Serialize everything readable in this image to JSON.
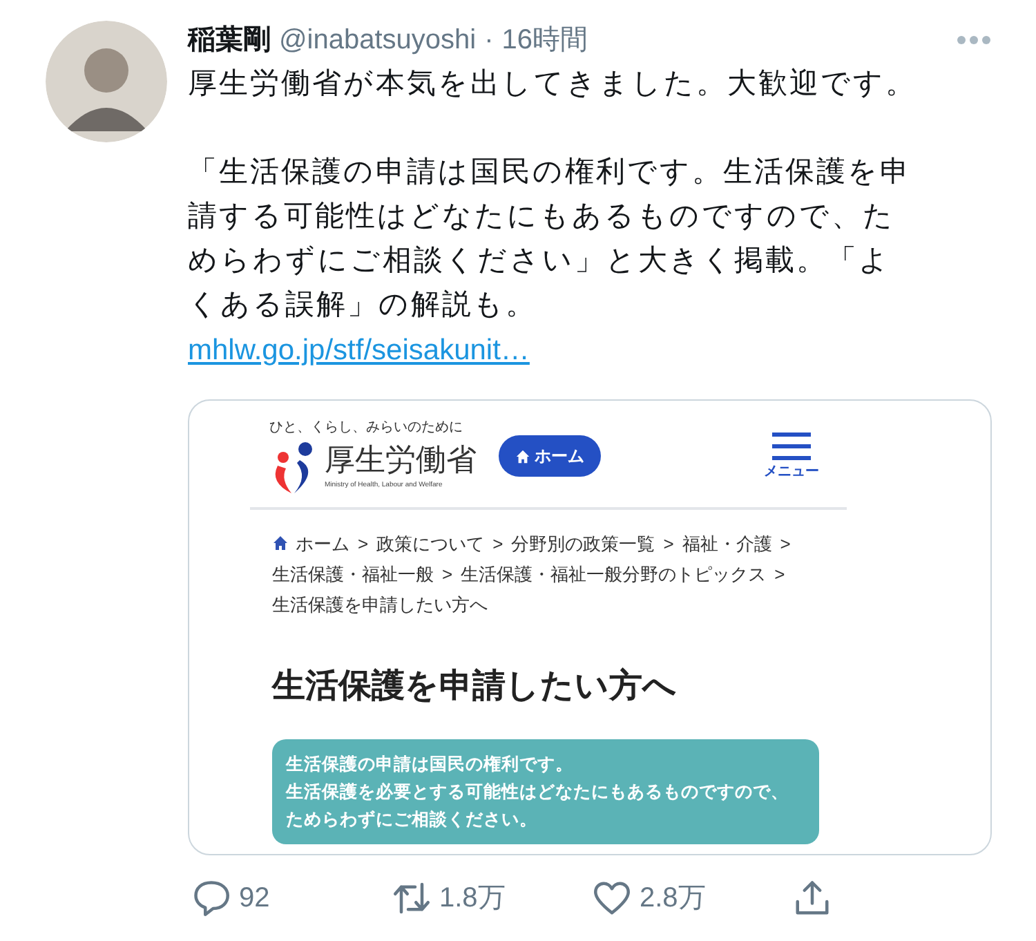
{
  "tweet": {
    "author_name": "稲葉剛",
    "handle": "@inabatsuyoshi",
    "separator": "·",
    "time": "16時間",
    "paragraphs": [
      "厚生労働省が本気を出してきました。大歓迎です。",
      "「生活保護の申請は国民の権利です。生活保護を申請する可能性はどなたにもあるものですので、ためらわずにご相談ください」と大きく掲載。「よくある誤解」の解説も。"
    ],
    "link": "mhlw.go.jp/stf/seisakunit…"
  },
  "preview": {
    "tagline": "ひと、くらし、みらいのために",
    "logo_text": "厚生労働省",
    "logo_subtitle": "Ministry of Health, Labour and Welfare",
    "home_button": "ホーム",
    "menu_label": "メニュー",
    "breadcrumb": [
      {
        "kind": "home",
        "label": "ホーム"
      },
      {
        "kind": "sep",
        "label": ">"
      },
      {
        "kind": "link",
        "label": "政策について"
      },
      {
        "kind": "sep",
        "label": ">"
      },
      {
        "kind": "link",
        "label": "分野別の政策一覧"
      },
      {
        "kind": "sep",
        "label": ">"
      },
      {
        "kind": "link",
        "label": "福祉・介護"
      },
      {
        "kind": "sep",
        "label": ">"
      },
      {
        "kind": "link",
        "label": "生活保護・福祉一般"
      },
      {
        "kind": "sep",
        "label": ">"
      },
      {
        "kind": "link",
        "label": "生活保護・福祉一般分野のトピックス"
      },
      {
        "kind": "sep",
        "label": ">"
      },
      {
        "kind": "current",
        "label": "生活保護を申請したい方へ"
      }
    ],
    "heading": "生活保護を申請したい方へ",
    "notice_lines": [
      "生活保護の申請は国民の権利です。",
      "生活保護を必要とする可能性はどなたにもあるものですので、",
      "ためらわずにご相談ください。"
    ]
  },
  "actions": [
    {
      "kind": "reply",
      "count": "92"
    },
    {
      "kind": "retweet",
      "count": "1.8万"
    },
    {
      "kind": "like",
      "count": "2.8万"
    },
    {
      "kind": "share"
    }
  ]
}
